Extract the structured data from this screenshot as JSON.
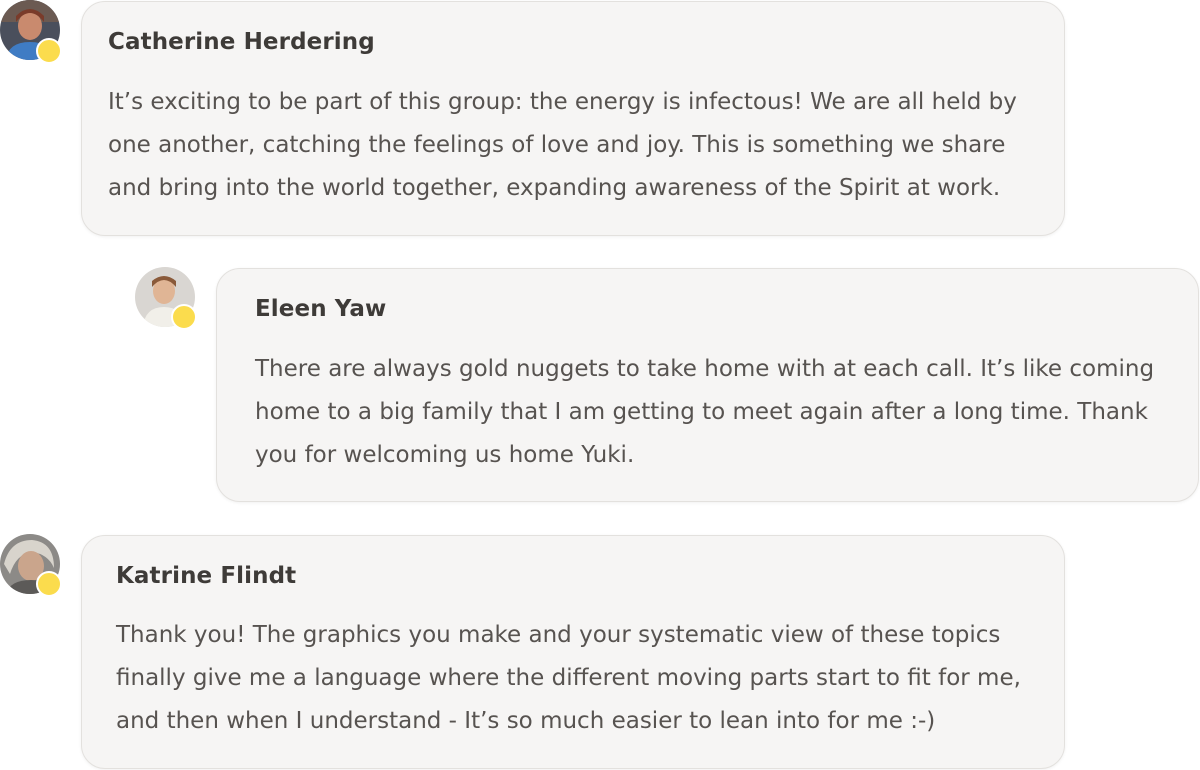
{
  "accent_colors": {
    "status_dot": "#fbdc4d",
    "bubble_background": "#f6f5f4",
    "bubble_border": "#e3e1de"
  },
  "messages": [
    {
      "author": "Catherine Herdering",
      "avatar_icon": "user-photo-avatar",
      "lines": [
        "It’s exciting to be part of this group: the energy is infectous! We are all held by",
        "one another, catching the feelings of love and joy. This is something we share",
        "and bring into the world together, expanding awareness of the Spirit at work."
      ]
    },
    {
      "author": "Eleen Yaw",
      "avatar_icon": "user-photo-avatar",
      "lines": [
        "There are always gold nuggets to take home with at each call. It’s like coming",
        "home to a big family that I am getting to meet again after a long time. Thank",
        "you for welcoming us home Yuki."
      ]
    },
    {
      "author": "Katrine Flindt",
      "avatar_icon": "user-photo-avatar",
      "lines": [
        "Thank you! The graphics you make and your systematic view of these topics",
        "finally give me a language where the different moving parts start to fit for me,",
        "and then when I understand - It’s so much easier to lean into for me :-)"
      ]
    }
  ]
}
